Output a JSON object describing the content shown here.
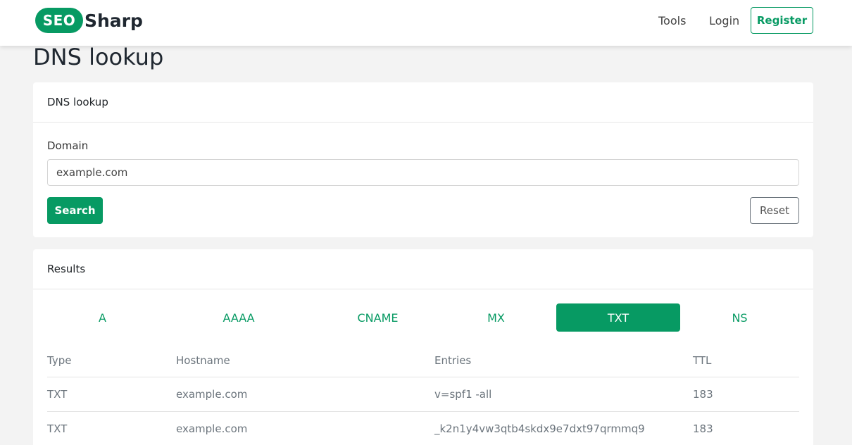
{
  "navbar": {
    "logo_pill": "SEO",
    "logo_text": "Sharp",
    "links": {
      "tools": "Tools",
      "login": "Login"
    },
    "register": "Register"
  },
  "page_title": "DNS lookup",
  "search_card": {
    "header": "DNS lookup",
    "domain_label": "Domain",
    "domain_value": "example.com",
    "search_button": "Search",
    "reset_button": "Reset"
  },
  "results_card": {
    "header": "Results",
    "tabs": [
      "A",
      "AAAA",
      "CNAME",
      "MX",
      "TXT",
      "NS"
    ],
    "active_tab": "TXT",
    "columns": [
      "Type",
      "Hostname",
      "Entries",
      "TTL"
    ],
    "rows": [
      [
        "TXT",
        "example.com",
        "v=spf1 -all",
        "183"
      ],
      [
        "TXT",
        "example.com",
        "_k2n1y4vw3qtb4skdx9e7dxt97qrmmq9",
        "183"
      ]
    ]
  },
  "colors": {
    "accent": "#079a63",
    "background": "#f3f3f3"
  }
}
